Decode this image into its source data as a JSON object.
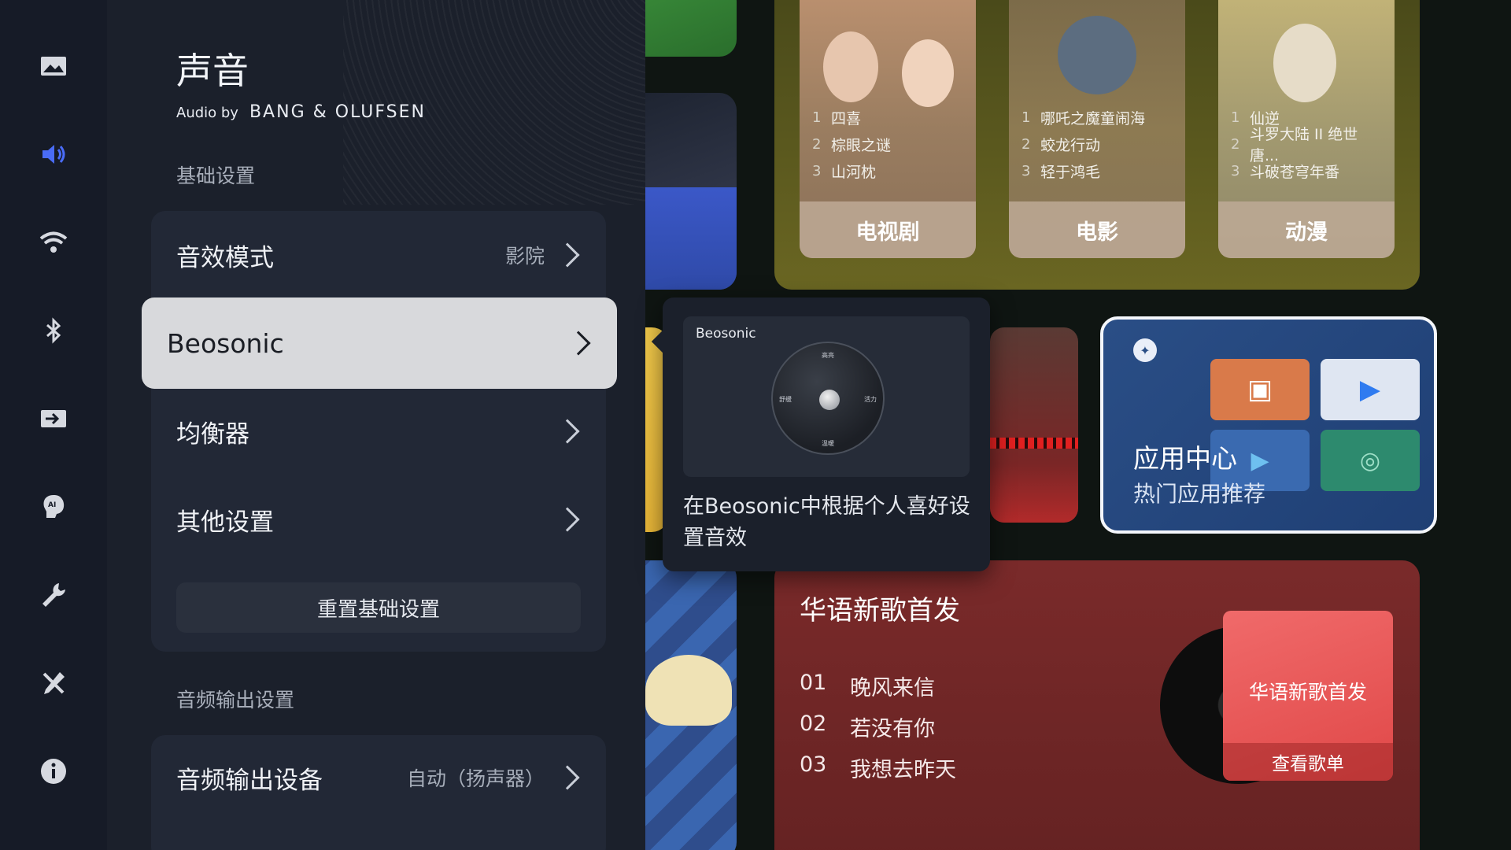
{
  "panel": {
    "title": "声音",
    "audio_by_prefix": "Audio by",
    "audio_by_brand": "BANG & OLUFSEN",
    "section_basic": "基础设置",
    "sound_mode_label": "音效模式",
    "sound_mode_value": "影院",
    "beosonic_label": "Beosonic",
    "equalizer_label": "均衡器",
    "other_settings_label": "其他设置",
    "reset_button": "重置基础设置",
    "section_output": "音频输出设置",
    "output_device_label": "音频输出设备",
    "output_device_value": "自动（扬声器）"
  },
  "nav": {
    "items": [
      {
        "icon": "picture-icon"
      },
      {
        "icon": "sound-icon",
        "active": true
      },
      {
        "icon": "wifi-icon"
      },
      {
        "icon": "bluetooth-icon"
      },
      {
        "icon": "input-source-icon"
      },
      {
        "icon": "ai-assistant-icon"
      },
      {
        "icon": "wrench-icon"
      },
      {
        "icon": "tools-icon"
      },
      {
        "icon": "info-icon"
      }
    ],
    "active_color": "#4a6cf7"
  },
  "tooltip": {
    "preview_title": "Beosonic",
    "dial_top": "高亮",
    "dial_left": "舒缓",
    "dial_right": "活力",
    "dial_bottom": "温暖",
    "text": "在Beosonic中根据个人喜好设置音效"
  },
  "video": {
    "categories": [
      {
        "label": "电视剧",
        "titles": [
          {
            "n": "1",
            "t": "四喜"
          },
          {
            "n": "2",
            "t": "棕眼之谜"
          },
          {
            "n": "3",
            "t": "山河枕"
          }
        ]
      },
      {
        "label": "电影",
        "titles": [
          {
            "n": "1",
            "t": "哪吒之魔童闹海"
          },
          {
            "n": "2",
            "t": "蛟龙行动"
          },
          {
            "n": "3",
            "t": "轻于鸿毛"
          }
        ]
      },
      {
        "label": "动漫",
        "titles": [
          {
            "n": "1",
            "t": "仙逆"
          },
          {
            "n": "2",
            "t": "斗罗大陆 II 绝世唐..."
          },
          {
            "n": "3",
            "t": "斗破苍穹年番"
          }
        ]
      }
    ]
  },
  "app_center": {
    "title": "应用中心",
    "subtitle": "热门应用推荐"
  },
  "music": {
    "title": "华语新歌首发",
    "songs": [
      {
        "no": "01",
        "name": "晚风来信"
      },
      {
        "no": "02",
        "name": "若没有你"
      },
      {
        "no": "03",
        "name": "我想去昨天"
      }
    ],
    "album_title": "华语新歌首发",
    "album_link": "查看歌单"
  }
}
